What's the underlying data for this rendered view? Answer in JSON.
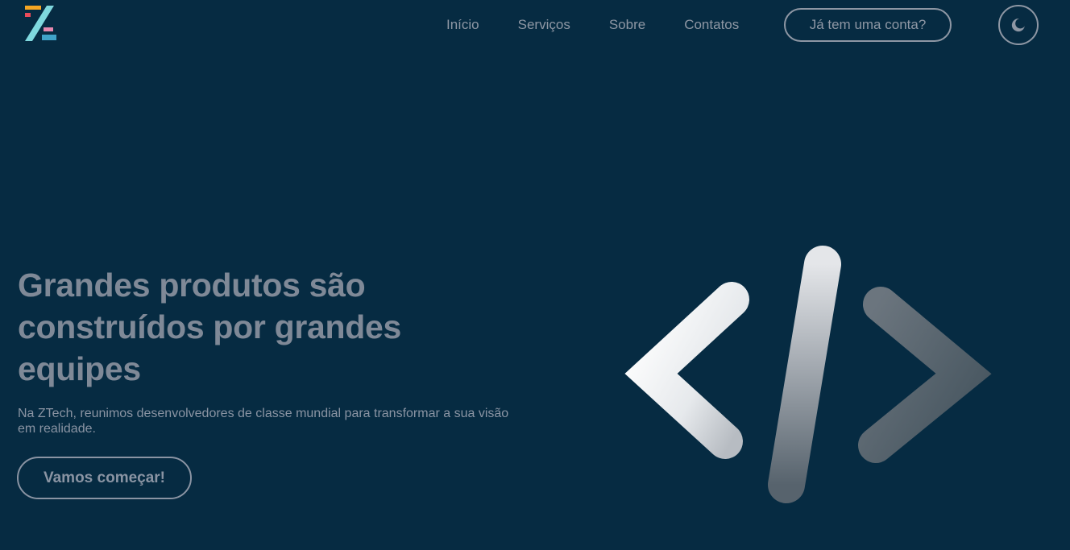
{
  "nav": {
    "logo_icon": "ztech-logo",
    "links": [
      "Início",
      "Serviços",
      "Sobre",
      "Contatos"
    ],
    "login_label": "Já tem uma conta?",
    "theme_icon": "moon-icon"
  },
  "hero": {
    "title": "Grandes produtos são construídos por grandes equipes",
    "subtitle": "Na ZTech, reunimos desenvolvedores de classe mundial para transformar a sua visão em realidade.",
    "cta_label": "Vamos começar!",
    "illustration_icon": "code-brackets-icon"
  },
  "colors": {
    "background": "#062B42",
    "text_muted": "#8A94A3",
    "logo_orange": "#F5A623",
    "logo_red": "#E94B5A",
    "logo_pink": "#E889B0",
    "logo_cyan": "#7FD8DE",
    "logo_blue": "#3FA3C9"
  }
}
